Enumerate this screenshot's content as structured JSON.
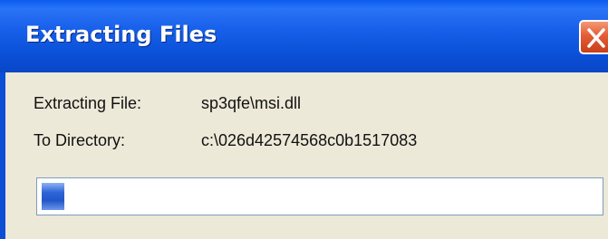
{
  "window": {
    "title": "Extracting Files"
  },
  "details": {
    "file_label": "Extracting File:",
    "file_value": "sp3qfe\\msi.dll",
    "dir_label": "To Directory:",
    "dir_value": "c:\\026d42574568c0b1517083"
  },
  "progress": {
    "fraction": 0.04
  },
  "icons": {
    "close": "close-icon"
  },
  "colors": {
    "titlebar": "#0a50d8",
    "close_button": "#e35d35",
    "progress_fill": "#2c66d8",
    "client_bg": "#ece9d8"
  }
}
